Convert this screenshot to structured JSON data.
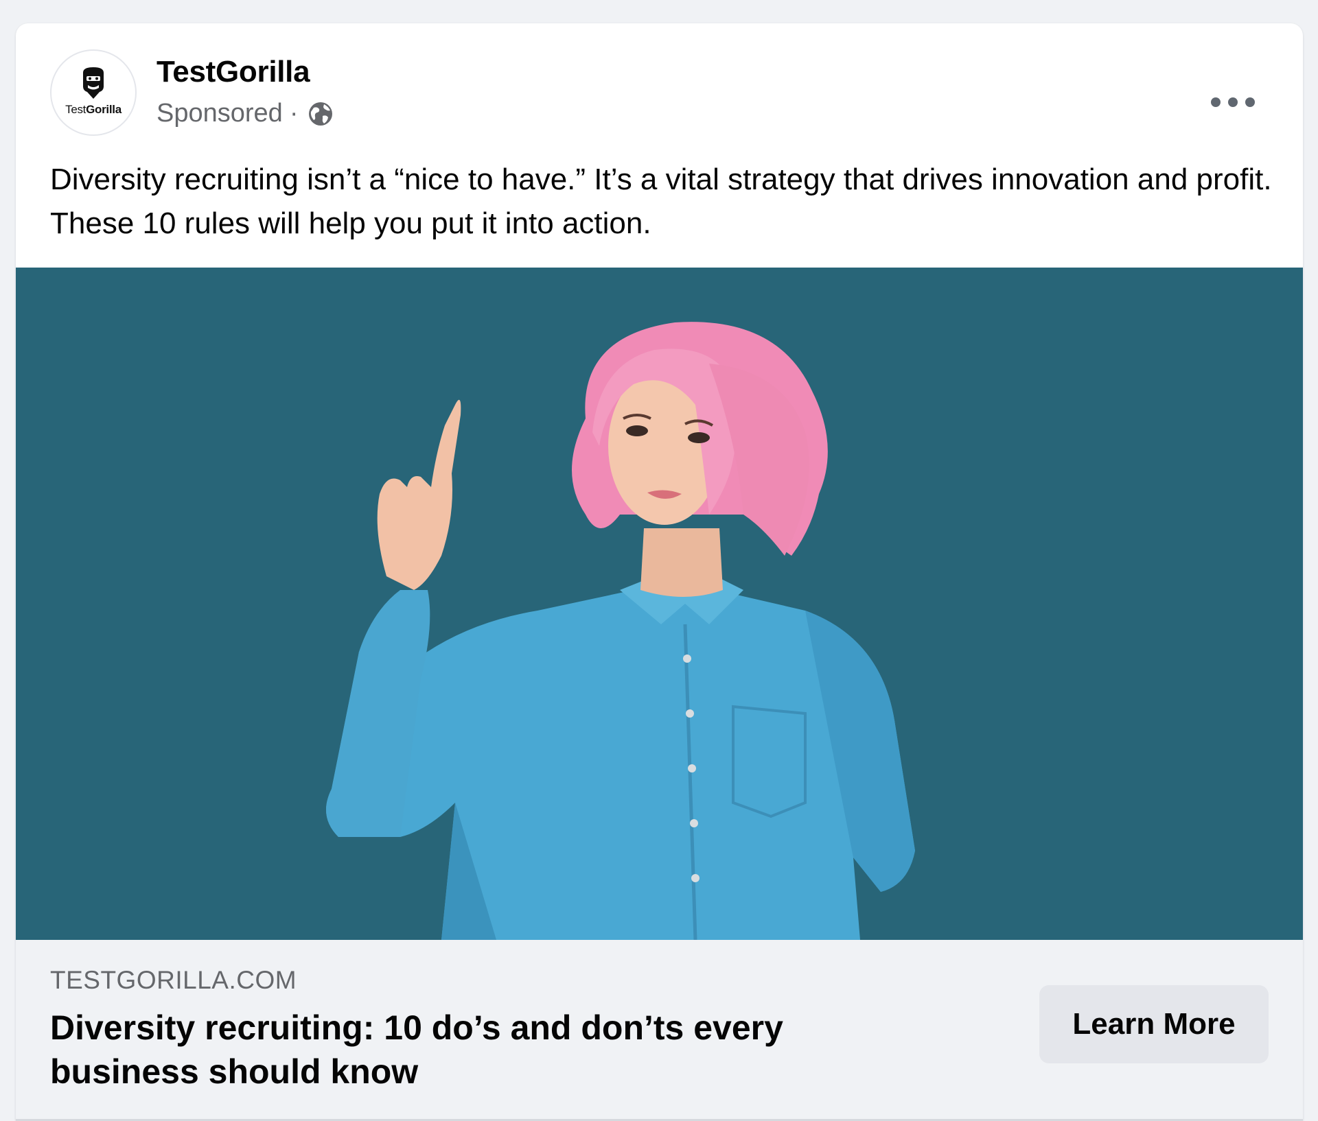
{
  "post": {
    "page_name": "TestGorilla",
    "avatar": {
      "brand_light": "Test",
      "brand_bold": "Gorilla",
      "icon": "gorilla-logo-icon"
    },
    "sponsored": "Sponsored",
    "separator": "·",
    "audience_icon": "globe-icon",
    "more_icon": "more-options-icon",
    "text": "Diversity recruiting isn’t a “nice to have.” It’s a vital strategy that drives innovation and profit. These 10 rules will help you put it into action."
  },
  "media": {
    "description_icon": "woman-pointing-up-photo",
    "background_color": "#286578"
  },
  "link": {
    "domain": "TESTGORILLA.COM",
    "headline": "Diversity recruiting: 10 do’s and don’ts every business should know",
    "cta_label": "Learn More"
  }
}
